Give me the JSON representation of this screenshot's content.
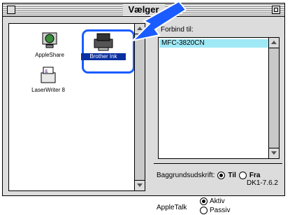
{
  "window": {
    "title": "Vælger"
  },
  "left_pane": {
    "icons": [
      {
        "label": "AppleShare"
      },
      {
        "label": "Brother Ink"
      },
      {
        "label": "LaserWriter 8"
      }
    ]
  },
  "right_pane": {
    "connect_label": "Forbind til:",
    "ports": [
      "MFC-3820CN"
    ],
    "background_print": {
      "label": "Baggrundsudskrift:",
      "on": "Til",
      "off": "Fra",
      "selected": "Til"
    },
    "appletalk": {
      "label": "AppleTalk",
      "active": "Aktiv",
      "passive": "Passiv",
      "selected": "Aktiv"
    },
    "version": "DK1-7.6.2"
  },
  "colors": {
    "highlight": "#9fe8f5",
    "selection_frame": "#1a5cff",
    "arrow": "#1a5cff"
  }
}
